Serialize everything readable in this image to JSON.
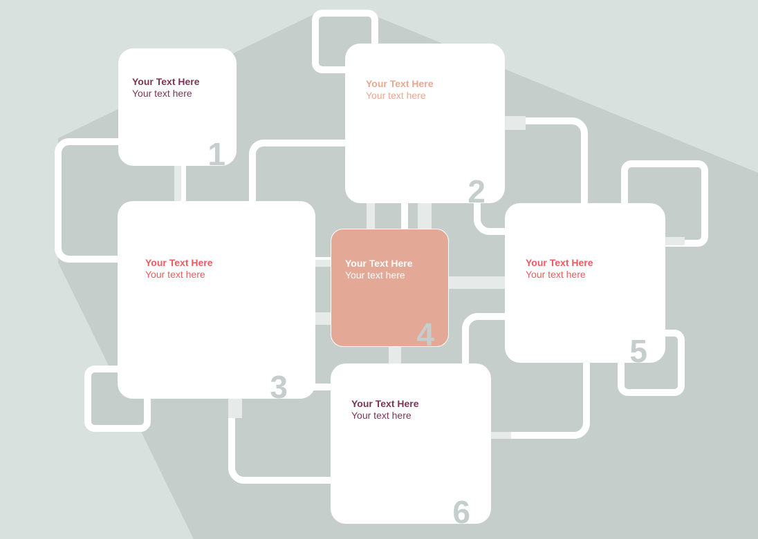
{
  "colors": {
    "background": "#d9e1df",
    "shadow": "#c6cecb",
    "card": "#ffffff",
    "accent_card": "#e3a896",
    "number": "#c5cecc",
    "purple_text": "#7a3556",
    "red_text": "#ef5a5f",
    "peach_text": "#e9a792"
  },
  "cards": [
    {
      "number": "1",
      "title": "Your Text Here",
      "subtitle": "Your text here"
    },
    {
      "number": "2",
      "title": "Your Text Here",
      "subtitle": "Your text here"
    },
    {
      "number": "3",
      "title": "Your Text Here",
      "subtitle": "Your text here"
    },
    {
      "number": "4",
      "title": "Your Text Here",
      "subtitle": "Your text here"
    },
    {
      "number": "5",
      "title": "Your Text Here",
      "subtitle": "Your text here"
    },
    {
      "number": "6",
      "title": "Your Text Here",
      "subtitle": "Your text here"
    }
  ]
}
